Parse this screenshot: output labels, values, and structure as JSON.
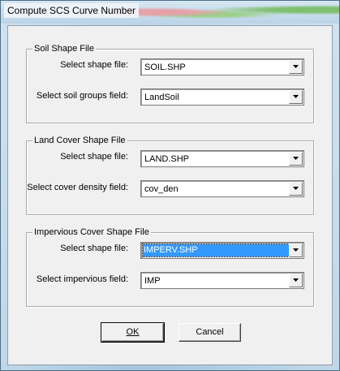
{
  "window": {
    "title": "Compute SCS Curve Number"
  },
  "soil": {
    "legend": "Soil Shape File",
    "shape_label": "Select shape file:",
    "shape_value": "SOIL.SHP",
    "field_label": "Select soil groups field:",
    "field_value": "LandSoil"
  },
  "land": {
    "legend": "Land Cover Shape File",
    "shape_label": "Select shape file:",
    "shape_value": "LAND.SHP",
    "field_label": "Select cover density field:",
    "field_value": "cov_den"
  },
  "imperv": {
    "legend": "Impervious Cover Shape File",
    "shape_label": "Select shape file:",
    "shape_value": "IMPERV.SHP",
    "field_label": "Select impervious field:",
    "field_value": "IMP"
  },
  "buttons": {
    "ok_label": "OK",
    "cancel_label": "Cancel"
  },
  "icons": {
    "dropdown": "chevron-down-icon"
  }
}
